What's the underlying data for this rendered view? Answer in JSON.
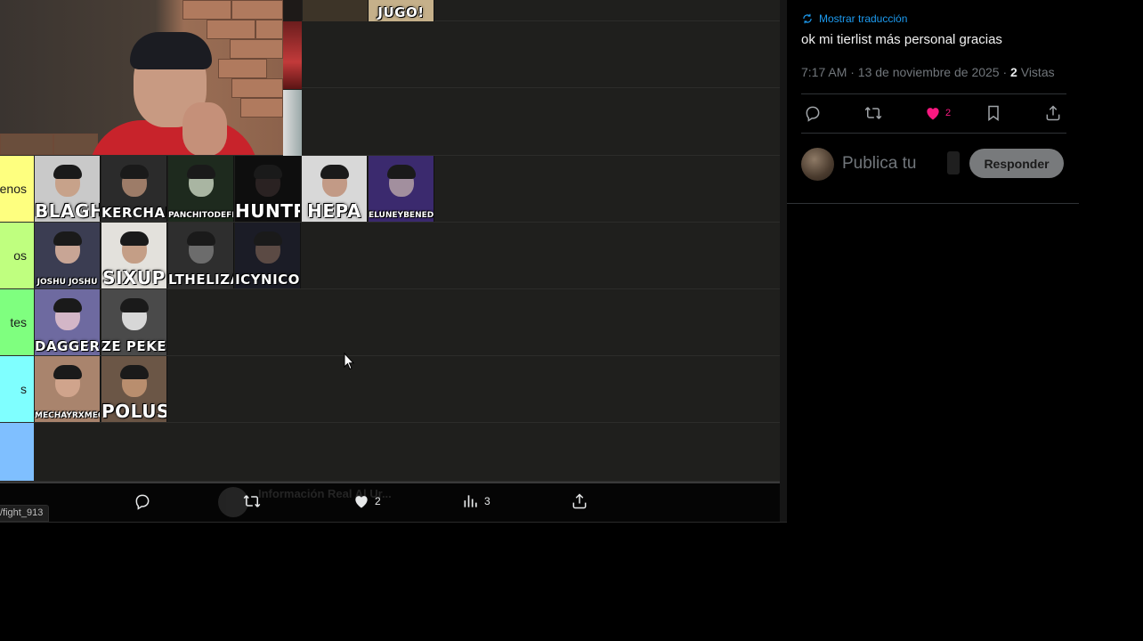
{
  "tiers": [
    {
      "label": "",
      "color": "#ffb380"
    },
    {
      "label": "",
      "color": "#ffd07f"
    },
    {
      "label": "",
      "color": "#ffdf80"
    },
    {
      "label": "enos",
      "color": "#feff7f"
    },
    {
      "label": "os",
      "color": "#bfff7f"
    },
    {
      "label": "tes",
      "color": "#7fff7f"
    },
    {
      "label": "s",
      "color": "#7fffff"
    },
    {
      "label": "",
      "color": "#7fbfff"
    }
  ],
  "top_tiles": [
    {
      "name": "",
      "bg": "#3d3428"
    },
    {
      "name": "JUGO!",
      "bg": "#c5b08a"
    }
  ],
  "row_tiles": [
    [
      {
        "name": "BLAGH",
        "bg": "#c9c9c9",
        "skin": "#c7a28a"
      },
      {
        "name": "KERCHAK",
        "bg": "#2b2b2b",
        "skin": "#9d7c68"
      },
      {
        "name": "PANCHITODEFLEUR",
        "bg": "#1e2a1e",
        "skin": "#a9b5a2"
      },
      {
        "name": "HUNTR",
        "bg": "#0e0e0e",
        "skin": "#2a2222"
      },
      {
        "name": "HEPA",
        "bg": "#d8d8d8",
        "skin": "#c29a86"
      },
      {
        "name": "ELUNEYBENEDETTI",
        "bg": "#3b2a6e",
        "skin": "#a28f9e"
      }
    ],
    [
      {
        "name": "JOSHU JOSHU",
        "bg": "#3b3d52",
        "skin": "#c8a595"
      },
      {
        "name": "SIXUP",
        "bg": "#e3e1dc",
        "skin": "#c49e86"
      },
      {
        "name": "LTHELIZARD",
        "bg": "#2e2e2e",
        "skin": "#6c6c6c"
      },
      {
        "name": "ICYNICO",
        "bg": "#1b1c26",
        "skin": "#5b4a44"
      }
    ],
    [
      {
        "name": "DAGGER",
        "bg": "#6e6aa0",
        "skin": "#d3b6c7"
      },
      {
        "name": "ZE PEKENA",
        "bg": "#4a4a4a",
        "skin": "#d7d7d7"
      }
    ],
    [
      {
        "name": "MECHAYRXMEO",
        "bg": "#a9846d",
        "skin": "#d0a48c"
      },
      {
        "name": "POLUS",
        "bg": "#6b5646",
        "skin": "#b98e6e"
      }
    ]
  ],
  "left_actions": {
    "reply_icon": "reply-icon",
    "retweet_icon": "retweet-icon",
    "like_icon": "heart-icon",
    "like_count": "2",
    "views_icon": "views-icon",
    "views_count": "3",
    "share_icon": "share-icon"
  },
  "url_chip": "/fight_913",
  "ghost_text": "Información Real Al Ur...",
  "tweet": {
    "translate_label": "Mostrar traducción",
    "text": "ok mi tierlist más personal gracias",
    "time": "7:17 AM · 13 de noviembre de 2025 · ",
    "views_count": "2",
    "views_label": " Vistas",
    "likes": "2",
    "like_color": "#f91880",
    "accent": "#1d9bf0"
  },
  "reply": {
    "placeholder": "Publica tu",
    "button_label": "Responder"
  }
}
